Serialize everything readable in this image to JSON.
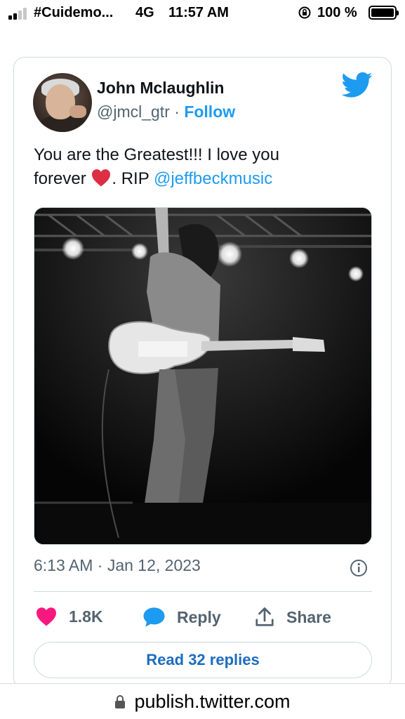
{
  "status_bar": {
    "carrier": "#Cuidemo...",
    "network": "4G",
    "time": "11:57 AM",
    "rotation_lock_icon": "rotation-lock-icon",
    "battery_percent": "100 %",
    "signal_bars_active": 2,
    "battery_level": 1.0
  },
  "tweet": {
    "author_name": "John Mclaughlin",
    "author_handle": "@jmcl_gtr",
    "separator": "·",
    "follow_label": "Follow",
    "text_line1": "You are the Greatest!!!  I love you",
    "text_before_heart": "forever ",
    "text_after_heart": ". RIP ",
    "mention": "@jeffbeckmusic",
    "timestamp": "6:13 AM · Jan 12, 2023",
    "likes_count": "1.8K",
    "reply_label": "Reply",
    "share_label": "Share",
    "read_replies_label": "Read 32 replies",
    "brand_color": "#1d9bf0",
    "like_color": "#f91880"
  },
  "browser": {
    "url": "publish.twitter.com"
  }
}
